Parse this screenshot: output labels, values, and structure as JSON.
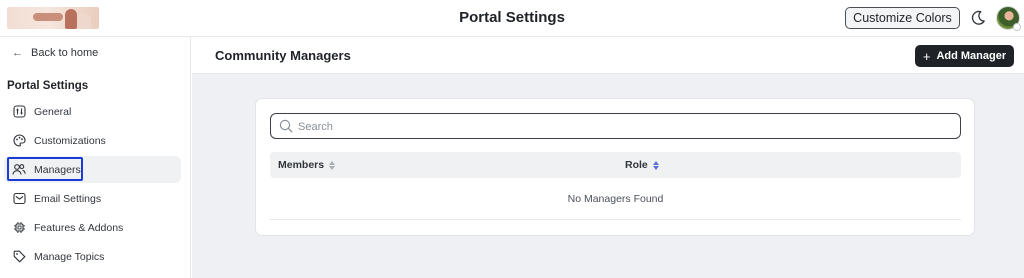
{
  "header": {
    "title": "Portal Settings",
    "customize_label": "Customize Colors",
    "theme_icon": "moon-icon",
    "avatar_icon": "user-avatar"
  },
  "sidebar": {
    "back_label": "Back to home",
    "section_title": "Portal Settings",
    "items": [
      {
        "label": "General",
        "icon": "sliders-icon",
        "active": false
      },
      {
        "label": "Customizations",
        "icon": "palette-icon",
        "active": false
      },
      {
        "label": "Managers",
        "icon": "users-icon",
        "active": true
      },
      {
        "label": "Email Settings",
        "icon": "mail-icon",
        "active": false
      },
      {
        "label": "Features & Addons",
        "icon": "chip-icon",
        "active": false
      },
      {
        "label": "Manage Topics",
        "icon": "tag-icon",
        "active": false
      }
    ]
  },
  "main": {
    "title": "Community Managers",
    "add_label": "Add Manager",
    "search": {
      "placeholder": "Search",
      "value": ""
    },
    "table": {
      "columns": [
        "Members",
        "Role"
      ],
      "sorted_column": "Role",
      "empty_text": "No Managers Found"
    }
  },
  "colors": {
    "accent": "#1a3bd6",
    "primary_button": "#1f2328",
    "sort_active": "#5a6fd6",
    "background": "#eff0f3"
  }
}
